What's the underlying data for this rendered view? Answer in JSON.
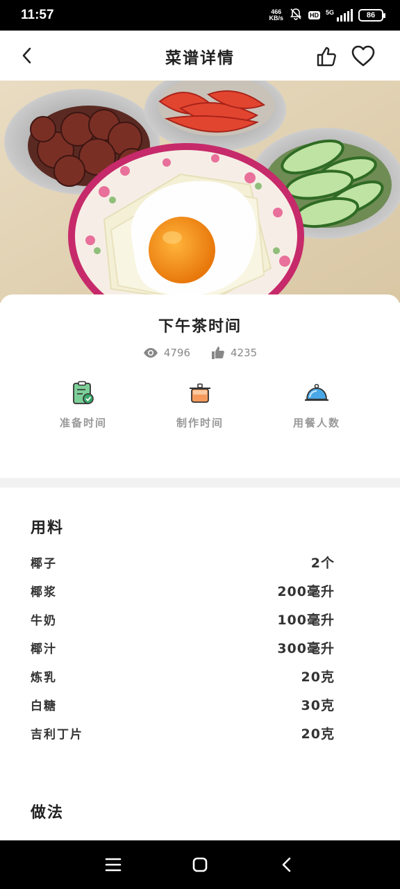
{
  "status_bar": {
    "time": "11:57",
    "net_speed_value": "466",
    "net_speed_unit": "KB/s",
    "hd_label": "HD",
    "network_label": "5G",
    "battery_level": "86",
    "icons": [
      "mute-bell-icon",
      "signal-icon",
      "battery-icon"
    ]
  },
  "app_bar": {
    "title": "菜谱详情",
    "icons": [
      "back-arrow-icon",
      "thumbs-up-icon",
      "heart-icon"
    ]
  },
  "recipe": {
    "title": "下午茶时间",
    "views": "4796",
    "likes": "4235",
    "meta": [
      {
        "label": "准备时间",
        "icon": "clipboard-timer-icon",
        "color": "#5dbb7f"
      },
      {
        "label": "制作时间",
        "icon": "cooking-pot-icon",
        "color": "#f08a4b"
      },
      {
        "label": "用餐人数",
        "icon": "serving-dish-icon",
        "color": "#3aa0e0"
      }
    ]
  },
  "ingredients": {
    "title": "用料",
    "items": [
      {
        "name": "椰子",
        "amount": "2个"
      },
      {
        "name": "椰浆",
        "amount": "200毫升"
      },
      {
        "name": "牛奶",
        "amount": "100毫升"
      },
      {
        "name": "椰汁",
        "amount": "300毫升"
      },
      {
        "name": "炼乳",
        "amount": "20克"
      },
      {
        "name": "白糖",
        "amount": "30克"
      },
      {
        "name": "吉利丁片",
        "amount": "20克"
      }
    ]
  },
  "method": {
    "title": "做法"
  },
  "nav_bar": {
    "icons": [
      "menu-icon",
      "home-square-icon",
      "back-chevron-icon"
    ]
  },
  "colors": {
    "accent_heart": "#222222",
    "muted_text": "#888888",
    "divider": "#f2f2f2"
  }
}
